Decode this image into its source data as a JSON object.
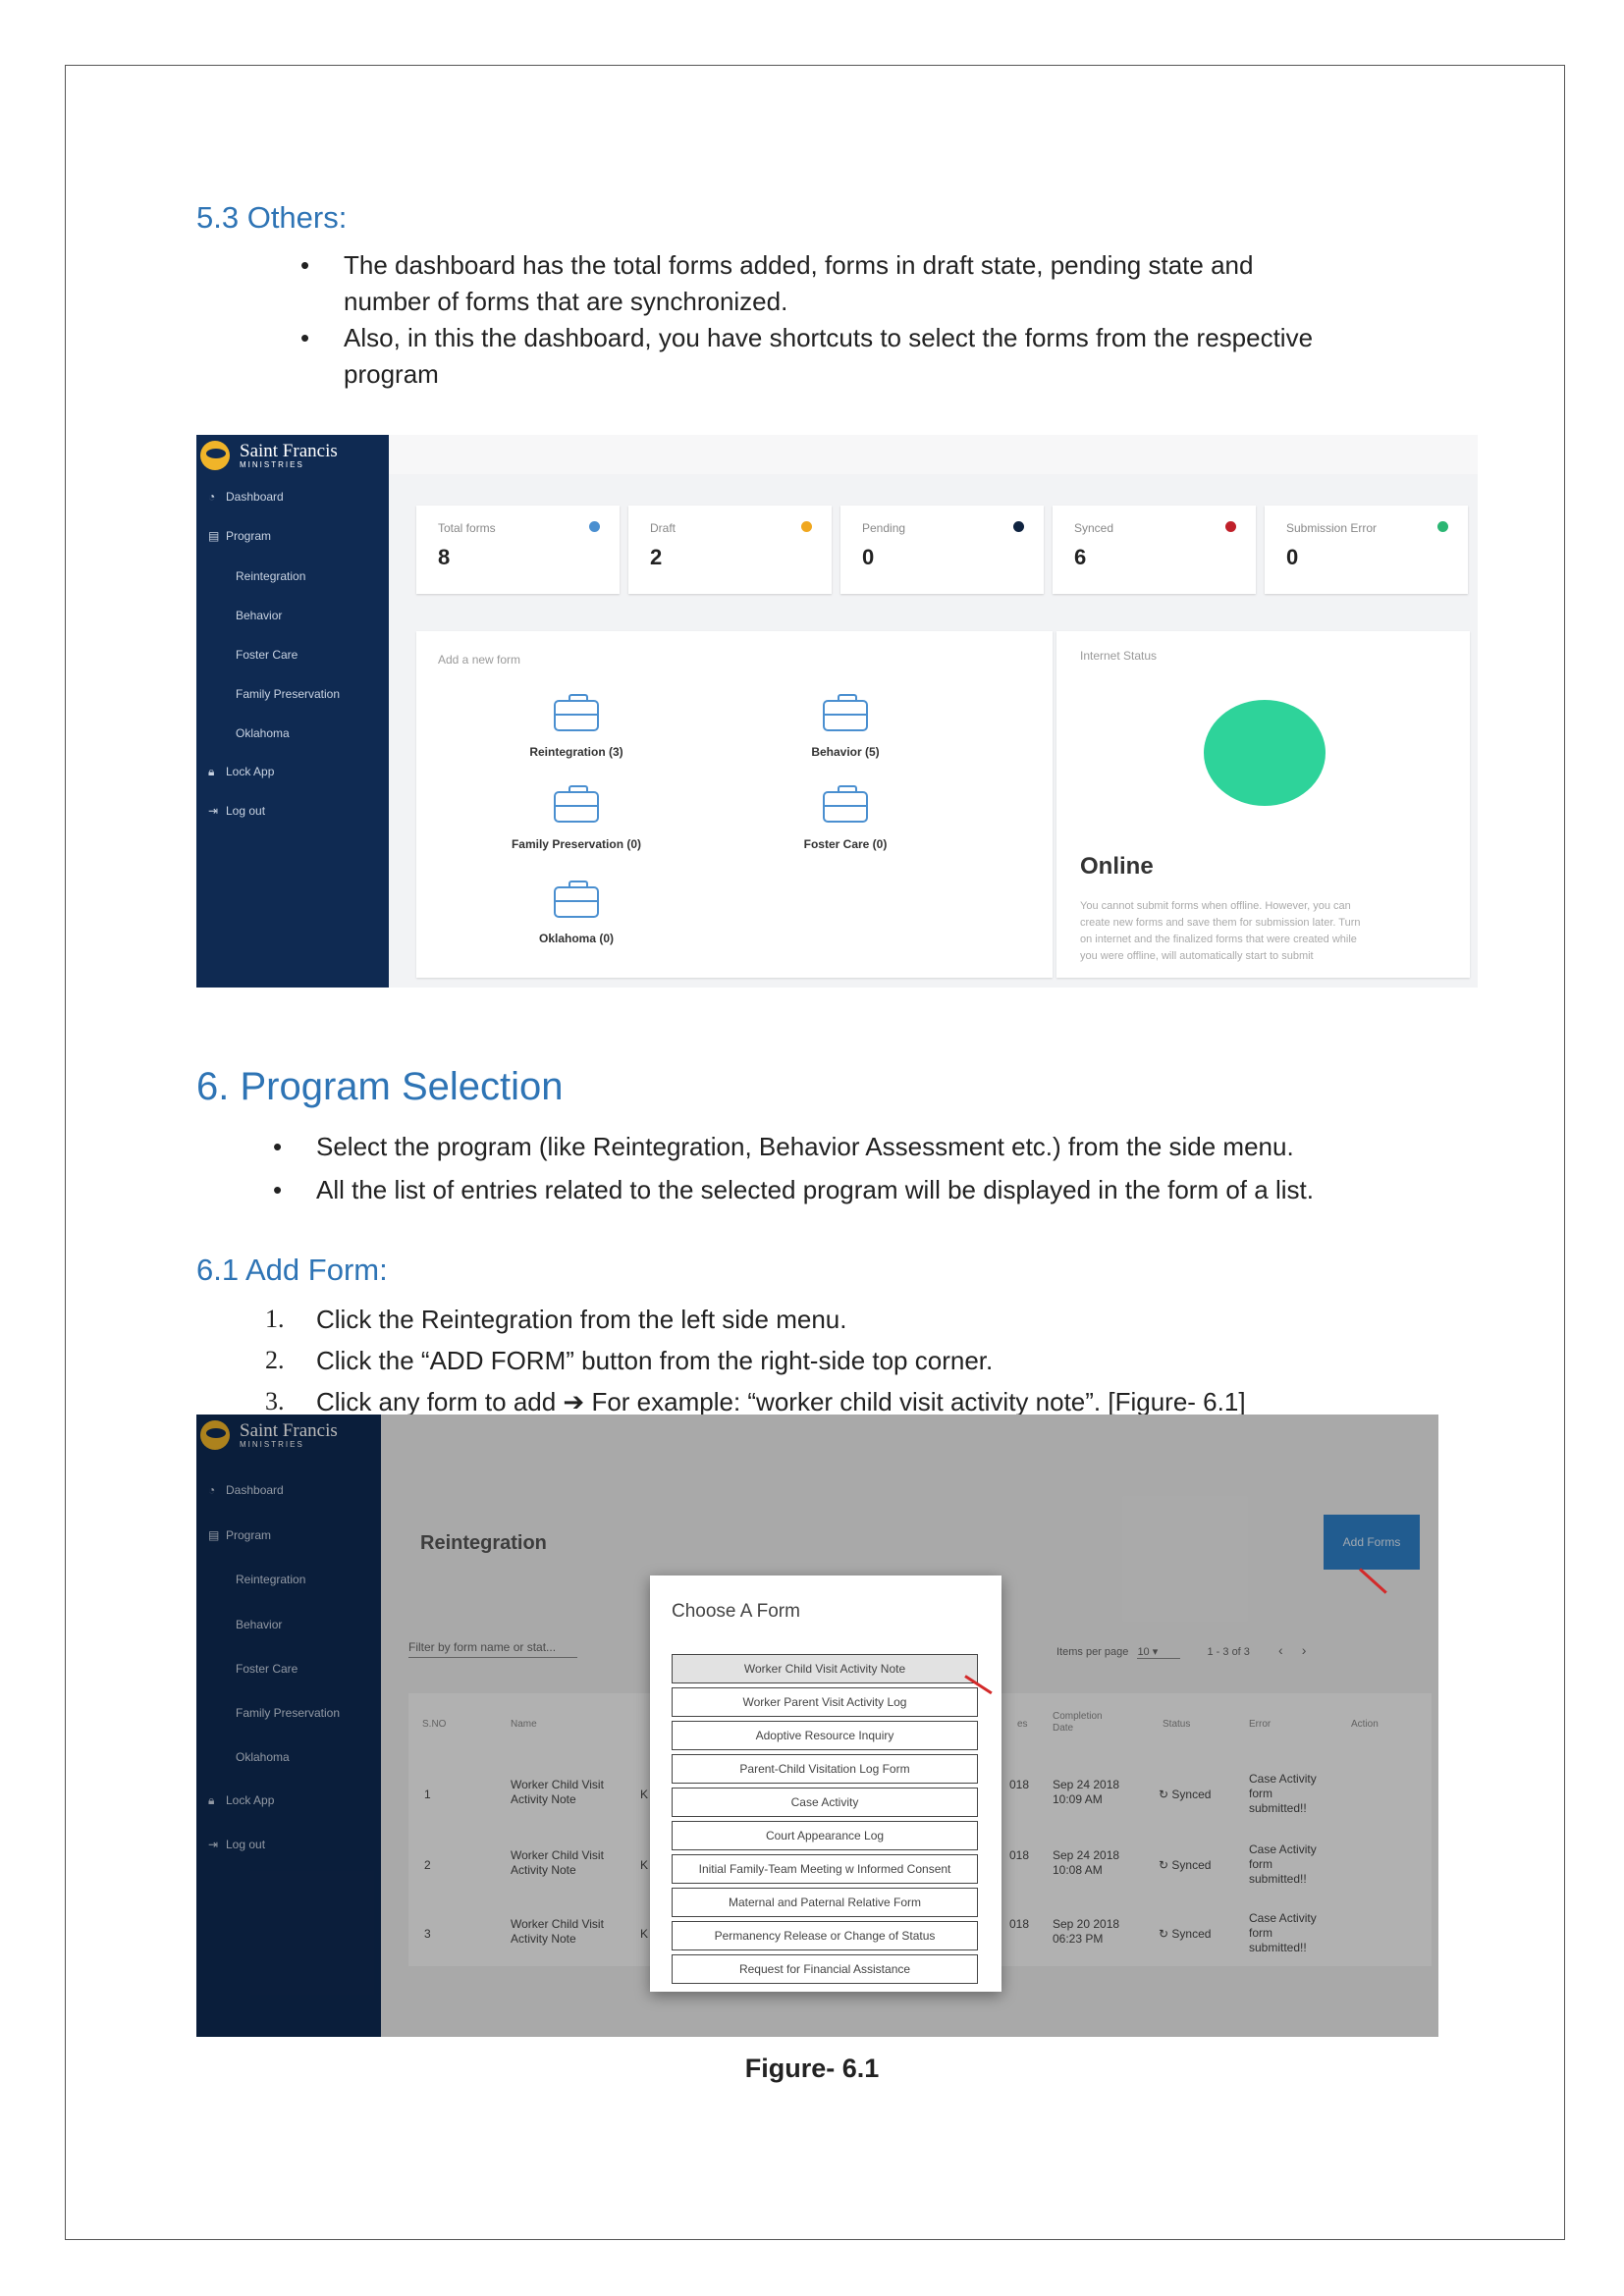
{
  "sec53": {
    "heading": "5.3 Others:",
    "bullets": [
      "The dashboard has the total forms added, forms in draft state, pending state and",
      "number of forms that are synchronized.",
      "Also, in this the dashboard, you have shortcuts to select the forms from the respective",
      "program"
    ]
  },
  "dashboard": {
    "logo": {
      "name": "Saint Francis",
      "sub": "MINISTRIES"
    },
    "nav": {
      "dashboard": "Dashboard",
      "program": "Program",
      "reintegration": "Reintegration",
      "behavior": "Behavior",
      "foster": "Foster Care",
      "family": "Family Preservation",
      "oklahoma": "Oklahoma",
      "lock": "Lock App",
      "logout": "Log out"
    },
    "stats": [
      {
        "label": "Total forms",
        "value": "8",
        "color": "#4a8fd0"
      },
      {
        "label": "Draft",
        "value": "2",
        "color": "#f0a71f"
      },
      {
        "label": "Pending",
        "value": "0",
        "color": "#0f2340"
      },
      {
        "label": "Synced",
        "value": "6",
        "color": "#c0202a"
      },
      {
        "label": "Submission Error",
        "value": "0",
        "color": "#2bb673"
      }
    ],
    "add_form_label": "Add a new form",
    "forms": {
      "reintegration": "Reintegration (3)",
      "behavior": "Behavior (5)",
      "family": "Family Preservation (0)",
      "foster": "Foster Care (0)",
      "oklahoma": "Oklahoma (0)"
    },
    "internet": {
      "label": "Internet Status",
      "status": "Online",
      "desc1": "You cannot submit forms when offline. However, you can",
      "desc2": "create new forms and save them for submission later. Turn",
      "desc3": "on internet and the finalized forms that were created while",
      "desc4": "you were offline, will automatically start to submit"
    }
  },
  "sec6": {
    "heading": "6.  Program Selection",
    "bullets": [
      "Select the program (like Reintegration, Behavior Assessment etc.) from the side menu.",
      "All the list of entries related to the selected program will be displayed in the form of a list."
    ]
  },
  "sec61": {
    "heading": "6.1 Add Form:",
    "steps": [
      {
        "n": "1.",
        "text": "Click the Reintegration from the left side menu."
      },
      {
        "n": "2.",
        "text": "Click the “ADD FORM” button from the right-side top corner."
      },
      {
        "n": "3.",
        "text": "Click any form to add ➔ For example: “worker child visit activity note”. [Figure- 6.1]"
      }
    ]
  },
  "reint": {
    "title": "Reintegration",
    "add_button": "Add Forms",
    "filter_placeholder": "Filter by form name or stat...",
    "items_per_page_label": "Items per page",
    "items_per_page": "10",
    "pagination": "1 - 3 of 3",
    "headers": [
      "S.NO",
      "Name",
      "",
      "es",
      "Completion Date",
      "Status",
      "Error",
      "Action"
    ],
    "rows": [
      {
        "sno": "1",
        "name1": "Worker Child Visit",
        "name2": "Activity Note",
        "k": "K",
        "yr": "018",
        "d1": "Sep 24 2018",
        "d2": "10:09 AM",
        "status": "Synced",
        "e1": "Case Activity",
        "e2": "form",
        "e3": "submitted!!"
      },
      {
        "sno": "2",
        "name1": "Worker Child Visit",
        "name2": "Activity Note",
        "k": "K",
        "yr": "018",
        "d1": "Sep 24 2018",
        "d2": "10:08 AM",
        "status": "Synced",
        "e1": "Case Activity",
        "e2": "form",
        "e3": "submitted!!"
      },
      {
        "sno": "3",
        "name1": "Worker Child Visit",
        "name2": "Activity Note",
        "k": "K",
        "yr": "018",
        "d1": "Sep 20 2018",
        "d2": "06:23 PM",
        "status": "Synced",
        "e1": "Case Activity",
        "e2": "form",
        "e3": "submitted!!"
      }
    ],
    "modal": {
      "title": "Choose A Form",
      "options": [
        "Worker Child Visit Activity Note",
        "Worker Parent Visit Activity Log",
        "Adoptive Resource Inquiry",
        "Parent-Child Visitation Log Form",
        "Case Activity",
        "Court Appearance Log",
        "Initial Family-Team Meeting w Informed Consent",
        "Maternal and Paternal Relative Form",
        "Permanency Release or Change of Status",
        "Request for Financial Assistance"
      ]
    }
  },
  "caption": "Figure- 6.1"
}
